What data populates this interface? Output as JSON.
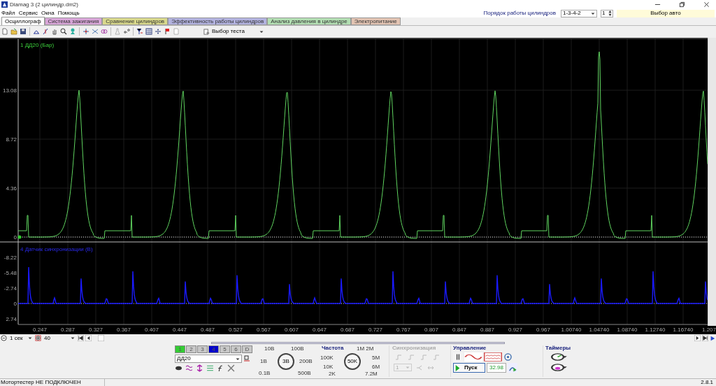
{
  "window": {
    "title": "Diamag 3 (2 цилиндр.dm2)"
  },
  "menu": [
    "Файл",
    "Сервис",
    "Окна",
    "Помощь"
  ],
  "cylinder_order": {
    "label": "Порядок работы цилиндров",
    "value": "1-3-4-2",
    "spinner": "1",
    "auto": "Выбор авто"
  },
  "tabs": [
    {
      "label": "Осциллограф",
      "selected": true,
      "color": "#ffffff"
    },
    {
      "label": "Система зажигания",
      "selected": false,
      "color": "#d9a6d9"
    },
    {
      "label": "Сравнение цилиндров",
      "selected": false,
      "color": "#d9d98c"
    },
    {
      "label": "Эффективность работы цилиндров",
      "selected": false,
      "color": "#b3b3e0"
    },
    {
      "label": "Анализ давления в цилиндре",
      "selected": false,
      "color": "#b3dfb3"
    },
    {
      "label": "Электропитание",
      "selected": false,
      "color": "#e3c4b3"
    }
  ],
  "toolbar": {
    "test_select": "Выбор теста"
  },
  "chart": {
    "upper": {
      "label": "1 ДД20 (Бар)",
      "yticks": [
        "13.08",
        "8.72",
        "4.36",
        "0"
      ]
    },
    "lower": {
      "label": "4 Датчик синхронизации (В)",
      "yticks": [
        "-8.22",
        "-5.48",
        "-2.74",
        "0",
        "2.74"
      ]
    },
    "xticks": [
      "0.247",
      "0.287",
      "0.327",
      "0.367",
      "0.407",
      "0.447",
      "0.487",
      "0.527",
      "0.567",
      "0.607",
      "0.647",
      "0.687",
      "0.727",
      "0.767",
      "0.807",
      "0.847",
      "0.887",
      "0.927",
      "0.967",
      "1.00740",
      "1.04740",
      "1.08740",
      "1.12740",
      "1.16740",
      "1.207"
    ]
  },
  "timeline": {
    "scale": "1 сек",
    "zoom": "40"
  },
  "controls": {
    "channels": [
      {
        "label": "1",
        "color": "#33cc33"
      },
      {
        "label": "2",
        "color": "#c8c8c8"
      },
      {
        "label": "3",
        "color": "#c8c8c8"
      },
      {
        "label": "4",
        "color": "#0000cc"
      },
      {
        "label": "5",
        "color": "#c8c8c8"
      },
      {
        "label": "6",
        "color": "#c8c8c8"
      },
      {
        "label": "D",
        "color": "#c8c8c8"
      }
    ],
    "sensor": "ДД20",
    "voltage": {
      "value": "3В",
      "marks": [
        "10В",
        "100В",
        "1В",
        "200В",
        "0.1В",
        "500В"
      ]
    },
    "frequency": {
      "title": "Частота",
      "value": "50K",
      "marks": [
        "1M 2M",
        "100K",
        "5M",
        "10K",
        "6M",
        "2K",
        "7.2M"
      ]
    },
    "sync": {
      "title": "Синхронизация",
      "disabled": true,
      "channel": "1"
    },
    "control": {
      "title": "Управление",
      "start": "Пуск",
      "reading": "32.98"
    },
    "timers": {
      "title": "Таймеры"
    }
  },
  "status_bar": {
    "message": "Мотортестер НЕ ПОДКЛЮЧЕН",
    "version": "2.8.1"
  }
}
